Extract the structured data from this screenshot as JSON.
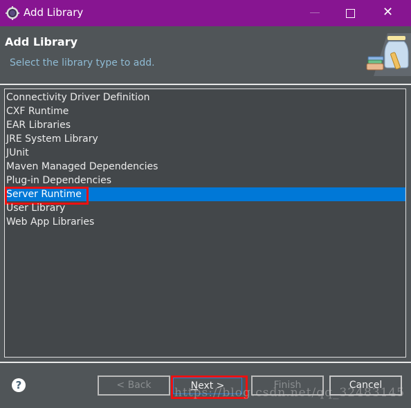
{
  "window": {
    "title": "Add Library",
    "controls": {
      "minimize": "—",
      "maximize": "□",
      "close": "✕"
    }
  },
  "header": {
    "title": "Add Library",
    "subtitle": "Select the library type to add."
  },
  "library_types": [
    {
      "label": "Connectivity Driver Definition",
      "selected": false
    },
    {
      "label": "CXF Runtime",
      "selected": false
    },
    {
      "label": "EAR Libraries",
      "selected": false
    },
    {
      "label": "JRE System Library",
      "selected": false
    },
    {
      "label": "JUnit",
      "selected": false
    },
    {
      "label": "Maven Managed Dependencies",
      "selected": false
    },
    {
      "label": "Plug-in Dependencies",
      "selected": false
    },
    {
      "label": "Server Runtime",
      "selected": true
    },
    {
      "label": "User Library",
      "selected": false
    },
    {
      "label": "Web App Libraries",
      "selected": false
    }
  ],
  "footer": {
    "help_icon": "?",
    "back_label": "< Back",
    "next_mnemonic": "N",
    "next_rest": "ext >",
    "finish_label": "Finish",
    "cancel_label": "Cancel"
  },
  "watermark": "https://blog.csdn.net/qq_32483145",
  "colors": {
    "titlebar": "#871591",
    "selection": "#0078d7",
    "highlight": "#ee1111"
  }
}
